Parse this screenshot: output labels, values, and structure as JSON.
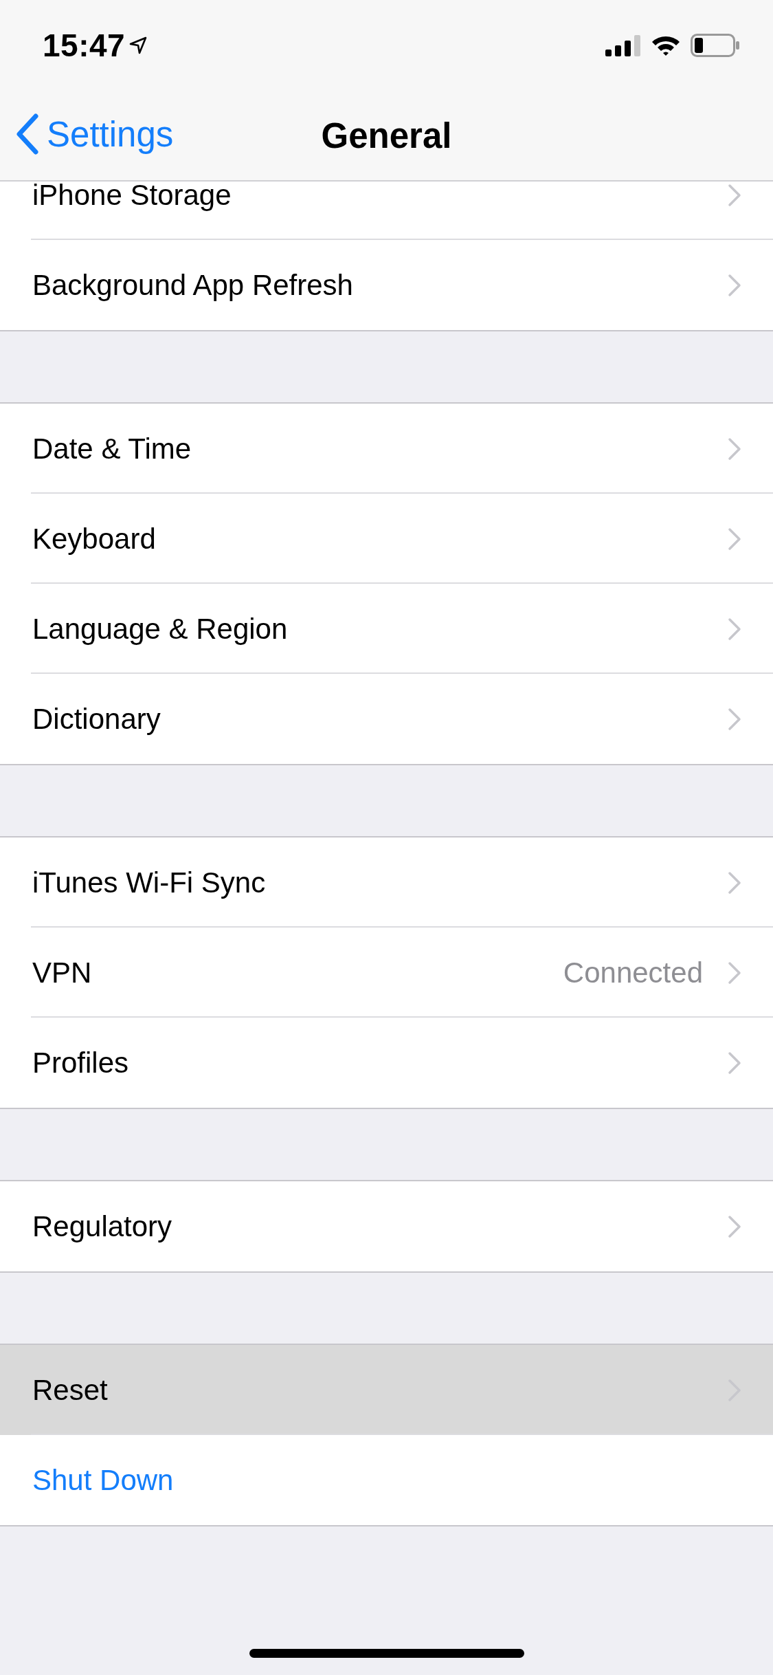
{
  "status_bar": {
    "time": "15:47"
  },
  "nav_bar": {
    "back": "Settings",
    "title": "General"
  },
  "sections": [
    {
      "rows": [
        {
          "label": "iPhone Storage",
          "kind": "nav",
          "selected": false
        },
        {
          "label": "Background App Refresh",
          "kind": "nav",
          "selected": false
        }
      ]
    },
    {
      "rows": [
        {
          "label": "Date & Time",
          "kind": "nav",
          "selected": false
        },
        {
          "label": "Keyboard",
          "kind": "nav",
          "selected": false
        },
        {
          "label": "Language & Region",
          "kind": "nav",
          "selected": false
        },
        {
          "label": "Dictionary",
          "kind": "nav",
          "selected": false
        }
      ]
    },
    {
      "rows": [
        {
          "label": "iTunes Wi-Fi Sync",
          "kind": "nav",
          "selected": false
        },
        {
          "label": "VPN",
          "value": "Connected",
          "kind": "nav",
          "selected": false
        },
        {
          "label": "Profiles",
          "kind": "nav",
          "selected": false
        }
      ]
    },
    {
      "rows": [
        {
          "label": "Regulatory",
          "kind": "nav",
          "selected": false
        }
      ]
    },
    {
      "rows": [
        {
          "label": "Reset",
          "kind": "nav",
          "selected": true
        },
        {
          "label": "Shut Down",
          "kind": "action",
          "selected": false
        }
      ]
    }
  ]
}
